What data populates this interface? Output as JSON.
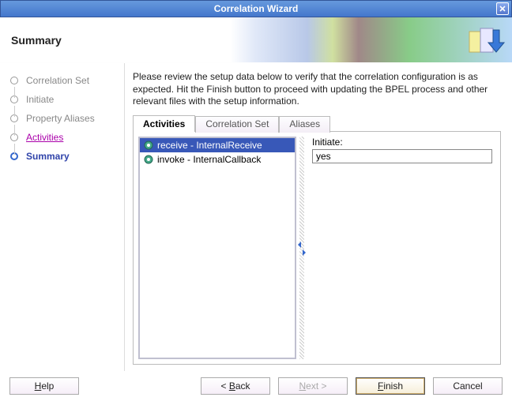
{
  "window": {
    "title": "Correlation Wizard"
  },
  "header": {
    "title": "Summary"
  },
  "steps": {
    "s0": "Correlation Set",
    "s1": "Initiate",
    "s2": "Property Aliases",
    "s3": "Activities",
    "s4": "Summary"
  },
  "instructions": "Please review the setup data below to verify that the correlation configuration is as expected. Hit the Finish button to proceed with updating the BPEL process and other relevant files with the setup information.",
  "tabs": {
    "activities": "Activities",
    "correlation_set": "Correlation Set",
    "aliases": "Aliases"
  },
  "activities": {
    "item0": "receive - InternalReceive",
    "item1": "invoke - InternalCallback"
  },
  "detail": {
    "initiate_label": "Initiate:",
    "initiate_value": "yes"
  },
  "buttons": {
    "help_pre": "H",
    "help_rest": "elp",
    "back_pre": "< ",
    "back_u": "B",
    "back_rest": "ack",
    "next_u": "N",
    "next_rest": "ext >",
    "finish_u": "F",
    "finish_rest": "inish",
    "cancel": "Cancel"
  }
}
